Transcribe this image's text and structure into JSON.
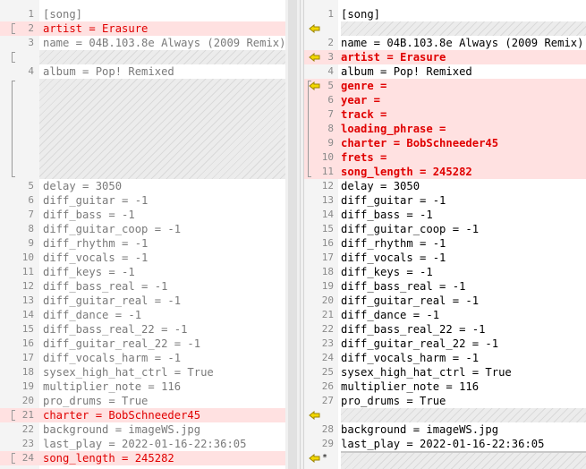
{
  "left": {
    "lines": [
      {
        "ln": "1",
        "text": "[song]",
        "diff": false
      },
      {
        "ln": "2",
        "text": "artist = Erasure",
        "diff": true
      },
      {
        "ln": "3",
        "text": "name = 04B.103.8e Always (2009 Remix)",
        "diff": false
      },
      {
        "ln": "4",
        "text": "album = Pop! Remixed",
        "diff": false
      },
      {
        "ln": "5",
        "text": "delay = 3050",
        "diff": false
      },
      {
        "ln": "6",
        "text": "diff_guitar = -1",
        "diff": false
      },
      {
        "ln": "7",
        "text": "diff_bass = -1",
        "diff": false
      },
      {
        "ln": "8",
        "text": "diff_guitar_coop = -1",
        "diff": false
      },
      {
        "ln": "9",
        "text": "diff_rhythm = -1",
        "diff": false
      },
      {
        "ln": "10",
        "text": "diff_vocals = -1",
        "diff": false
      },
      {
        "ln": "11",
        "text": "diff_keys = -1",
        "diff": false
      },
      {
        "ln": "12",
        "text": "diff_bass_real = -1",
        "diff": false
      },
      {
        "ln": "13",
        "text": "diff_guitar_real = -1",
        "diff": false
      },
      {
        "ln": "14",
        "text": "diff_dance = -1",
        "diff": false
      },
      {
        "ln": "15",
        "text": "diff_bass_real_22 = -1",
        "diff": false
      },
      {
        "ln": "16",
        "text": "diff_guitar_real_22 = -1",
        "diff": false
      },
      {
        "ln": "17",
        "text": "diff_vocals_harm = -1",
        "diff": false
      },
      {
        "ln": "18",
        "text": "sysex_high_hat_ctrl = True",
        "diff": false
      },
      {
        "ln": "19",
        "text": "multiplier_note = 116",
        "diff": false
      },
      {
        "ln": "20",
        "text": "pro_drums = True",
        "diff": false
      },
      {
        "ln": "21",
        "text": "charter = BobSchneeder45",
        "diff": true
      },
      {
        "ln": "22",
        "text": "background = imageWS.jpg",
        "diff": false
      },
      {
        "ln": "23",
        "text": "last_play = 2022-01-16-22:36:05",
        "diff": false
      },
      {
        "ln": "24",
        "text": "song_length = 245282",
        "diff": true
      }
    ]
  },
  "right": {
    "lines": [
      {
        "ln": "1",
        "text": "[song]",
        "diff": false
      },
      {
        "ln": "2",
        "text": "name = 04B.103.8e Always (2009 Remix)",
        "diff": false
      },
      {
        "ln": "3",
        "text": "artist = Erasure",
        "diff": true
      },
      {
        "ln": "4",
        "text": "album = Pop! Remixed",
        "diff": false
      },
      {
        "ln": "5",
        "text": "genre =",
        "diff": true
      },
      {
        "ln": "6",
        "text": "year =",
        "diff": true
      },
      {
        "ln": "7",
        "text": "track =",
        "diff": true
      },
      {
        "ln": "8",
        "text": "loading_phrase =",
        "diff": true
      },
      {
        "ln": "9",
        "text": "charter = BobSchneeder45",
        "diff": true
      },
      {
        "ln": "10",
        "text": "frets =",
        "diff": true
      },
      {
        "ln": "11",
        "text": "song_length = 245282",
        "diff": true
      },
      {
        "ln": "12",
        "text": "delay = 3050",
        "diff": false
      },
      {
        "ln": "13",
        "text": "diff_guitar = -1",
        "diff": false
      },
      {
        "ln": "14",
        "text": "diff_bass = -1",
        "diff": false
      },
      {
        "ln": "15",
        "text": "diff_guitar_coop = -1",
        "diff": false
      },
      {
        "ln": "16",
        "text": "diff_rhythm = -1",
        "diff": false
      },
      {
        "ln": "17",
        "text": "diff_vocals = -1",
        "diff": false
      },
      {
        "ln": "18",
        "text": "diff_keys = -1",
        "diff": false
      },
      {
        "ln": "19",
        "text": "diff_bass_real = -1",
        "diff": false
      },
      {
        "ln": "20",
        "text": "diff_guitar_real = -1",
        "diff": false
      },
      {
        "ln": "21",
        "text": "diff_dance = -1",
        "diff": false
      },
      {
        "ln": "22",
        "text": "diff_bass_real_22 = -1",
        "diff": false
      },
      {
        "ln": "23",
        "text": "diff_guitar_real_22 = -1",
        "diff": false
      },
      {
        "ln": "24",
        "text": "diff_vocals_harm = -1",
        "diff": false
      },
      {
        "ln": "25",
        "text": "sysex_high_hat_ctrl = True",
        "diff": false
      },
      {
        "ln": "26",
        "text": "multiplier_note = 116",
        "diff": false
      },
      {
        "ln": "27",
        "text": "pro_drums = True",
        "diff": false
      },
      {
        "ln": "28",
        "text": "background = imageWS.jpg",
        "diff": false
      },
      {
        "ln": "29",
        "text": "last_play = 2022-01-16-22:36:05",
        "diff": false
      }
    ],
    "end_marker": "*"
  },
  "colors": {
    "diff_background": "#ffe1e1",
    "diff_text": "#e00000",
    "arrow": "#e6c200"
  },
  "icons": [
    "copy-left-arrow-icon",
    "change-bracket-icon"
  ]
}
